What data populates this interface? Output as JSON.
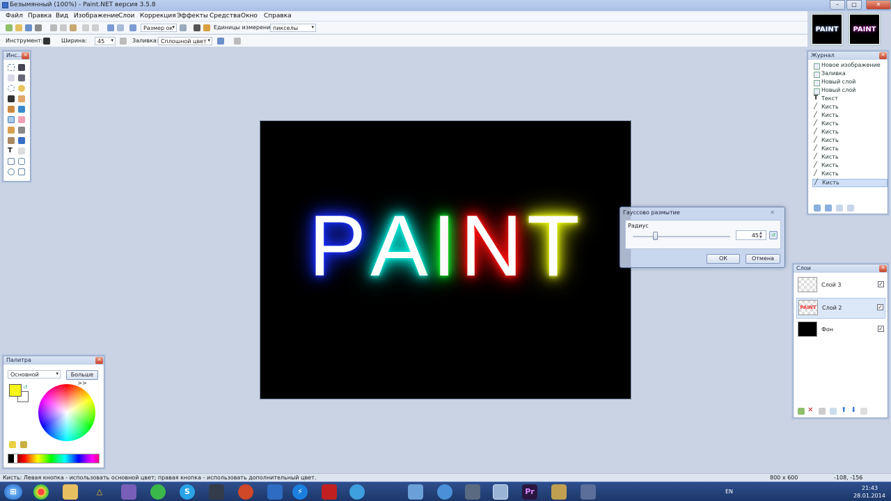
{
  "window": {
    "title": "Безымянный (100%) - Paint.NET версия 3.5.8"
  },
  "menu": [
    "Файл",
    "Правка",
    "Вид",
    "Изображение",
    "Слои",
    "Коррекция",
    "Эффекты",
    "Средства",
    "Окно",
    "Справка"
  ],
  "toolbar1": {
    "zoom_combo": "Размер ок",
    "units_label": "Единицы измерения:",
    "units_value": "пикселы"
  },
  "toolbar2": {
    "tool_label": "Инструмент:",
    "width_label": "Ширина:",
    "width_value": "45",
    "fill_label": "Заливка:",
    "fill_value": "Сплошной цвет"
  },
  "thumbnails": [
    "PAINT",
    "PAINT"
  ],
  "tools_panel": {
    "title": "Инс..."
  },
  "canvas": {
    "letters": [
      {
        "char": "P",
        "glow": "#1a30ff"
      },
      {
        "char": "A",
        "glow": "#00f0e0"
      },
      {
        "char": "I",
        "glow": "#10ff30"
      },
      {
        "char": "N",
        "glow": "#ff1010"
      },
      {
        "char": "T",
        "glow": "#f0ff10"
      }
    ]
  },
  "history": {
    "title": "Журнал",
    "items": [
      "Новое изображение",
      "Заливка",
      "Новый слой",
      "Новый слой",
      "Текст",
      "Кисть",
      "Кисть",
      "Кисть",
      "Кисть",
      "Кисть",
      "Кисть",
      "Кисть",
      "Кисть",
      "Кисть",
      "Кисть"
    ],
    "selected_index": 14
  },
  "dialog": {
    "title": "Гауссово размытие",
    "radius_label": "Радиус",
    "radius_value": "45",
    "ok": "ОК",
    "cancel": "Отмена"
  },
  "layers": {
    "title": "Слои",
    "items": [
      {
        "name": "Слой 3",
        "checked": true
      },
      {
        "name": "Слой 2",
        "checked": true
      },
      {
        "name": "Фон",
        "checked": true
      }
    ],
    "selected_index": 1
  },
  "palette": {
    "title": "Палитра",
    "mode": "Основной",
    "more_button": "Больше >>",
    "primary_color": "#f5f518",
    "secondary_color": "#ffffff"
  },
  "status": {
    "hint": "Кисть: Левая кнопка - использовать основной цвет; правая кнопка - использовать дополнительный цвет.",
    "size": "800 x 600",
    "pos": "-108, -156"
  },
  "taskbar": {
    "lang": "EN",
    "time": "21:43",
    "date": "28.01.2014"
  }
}
